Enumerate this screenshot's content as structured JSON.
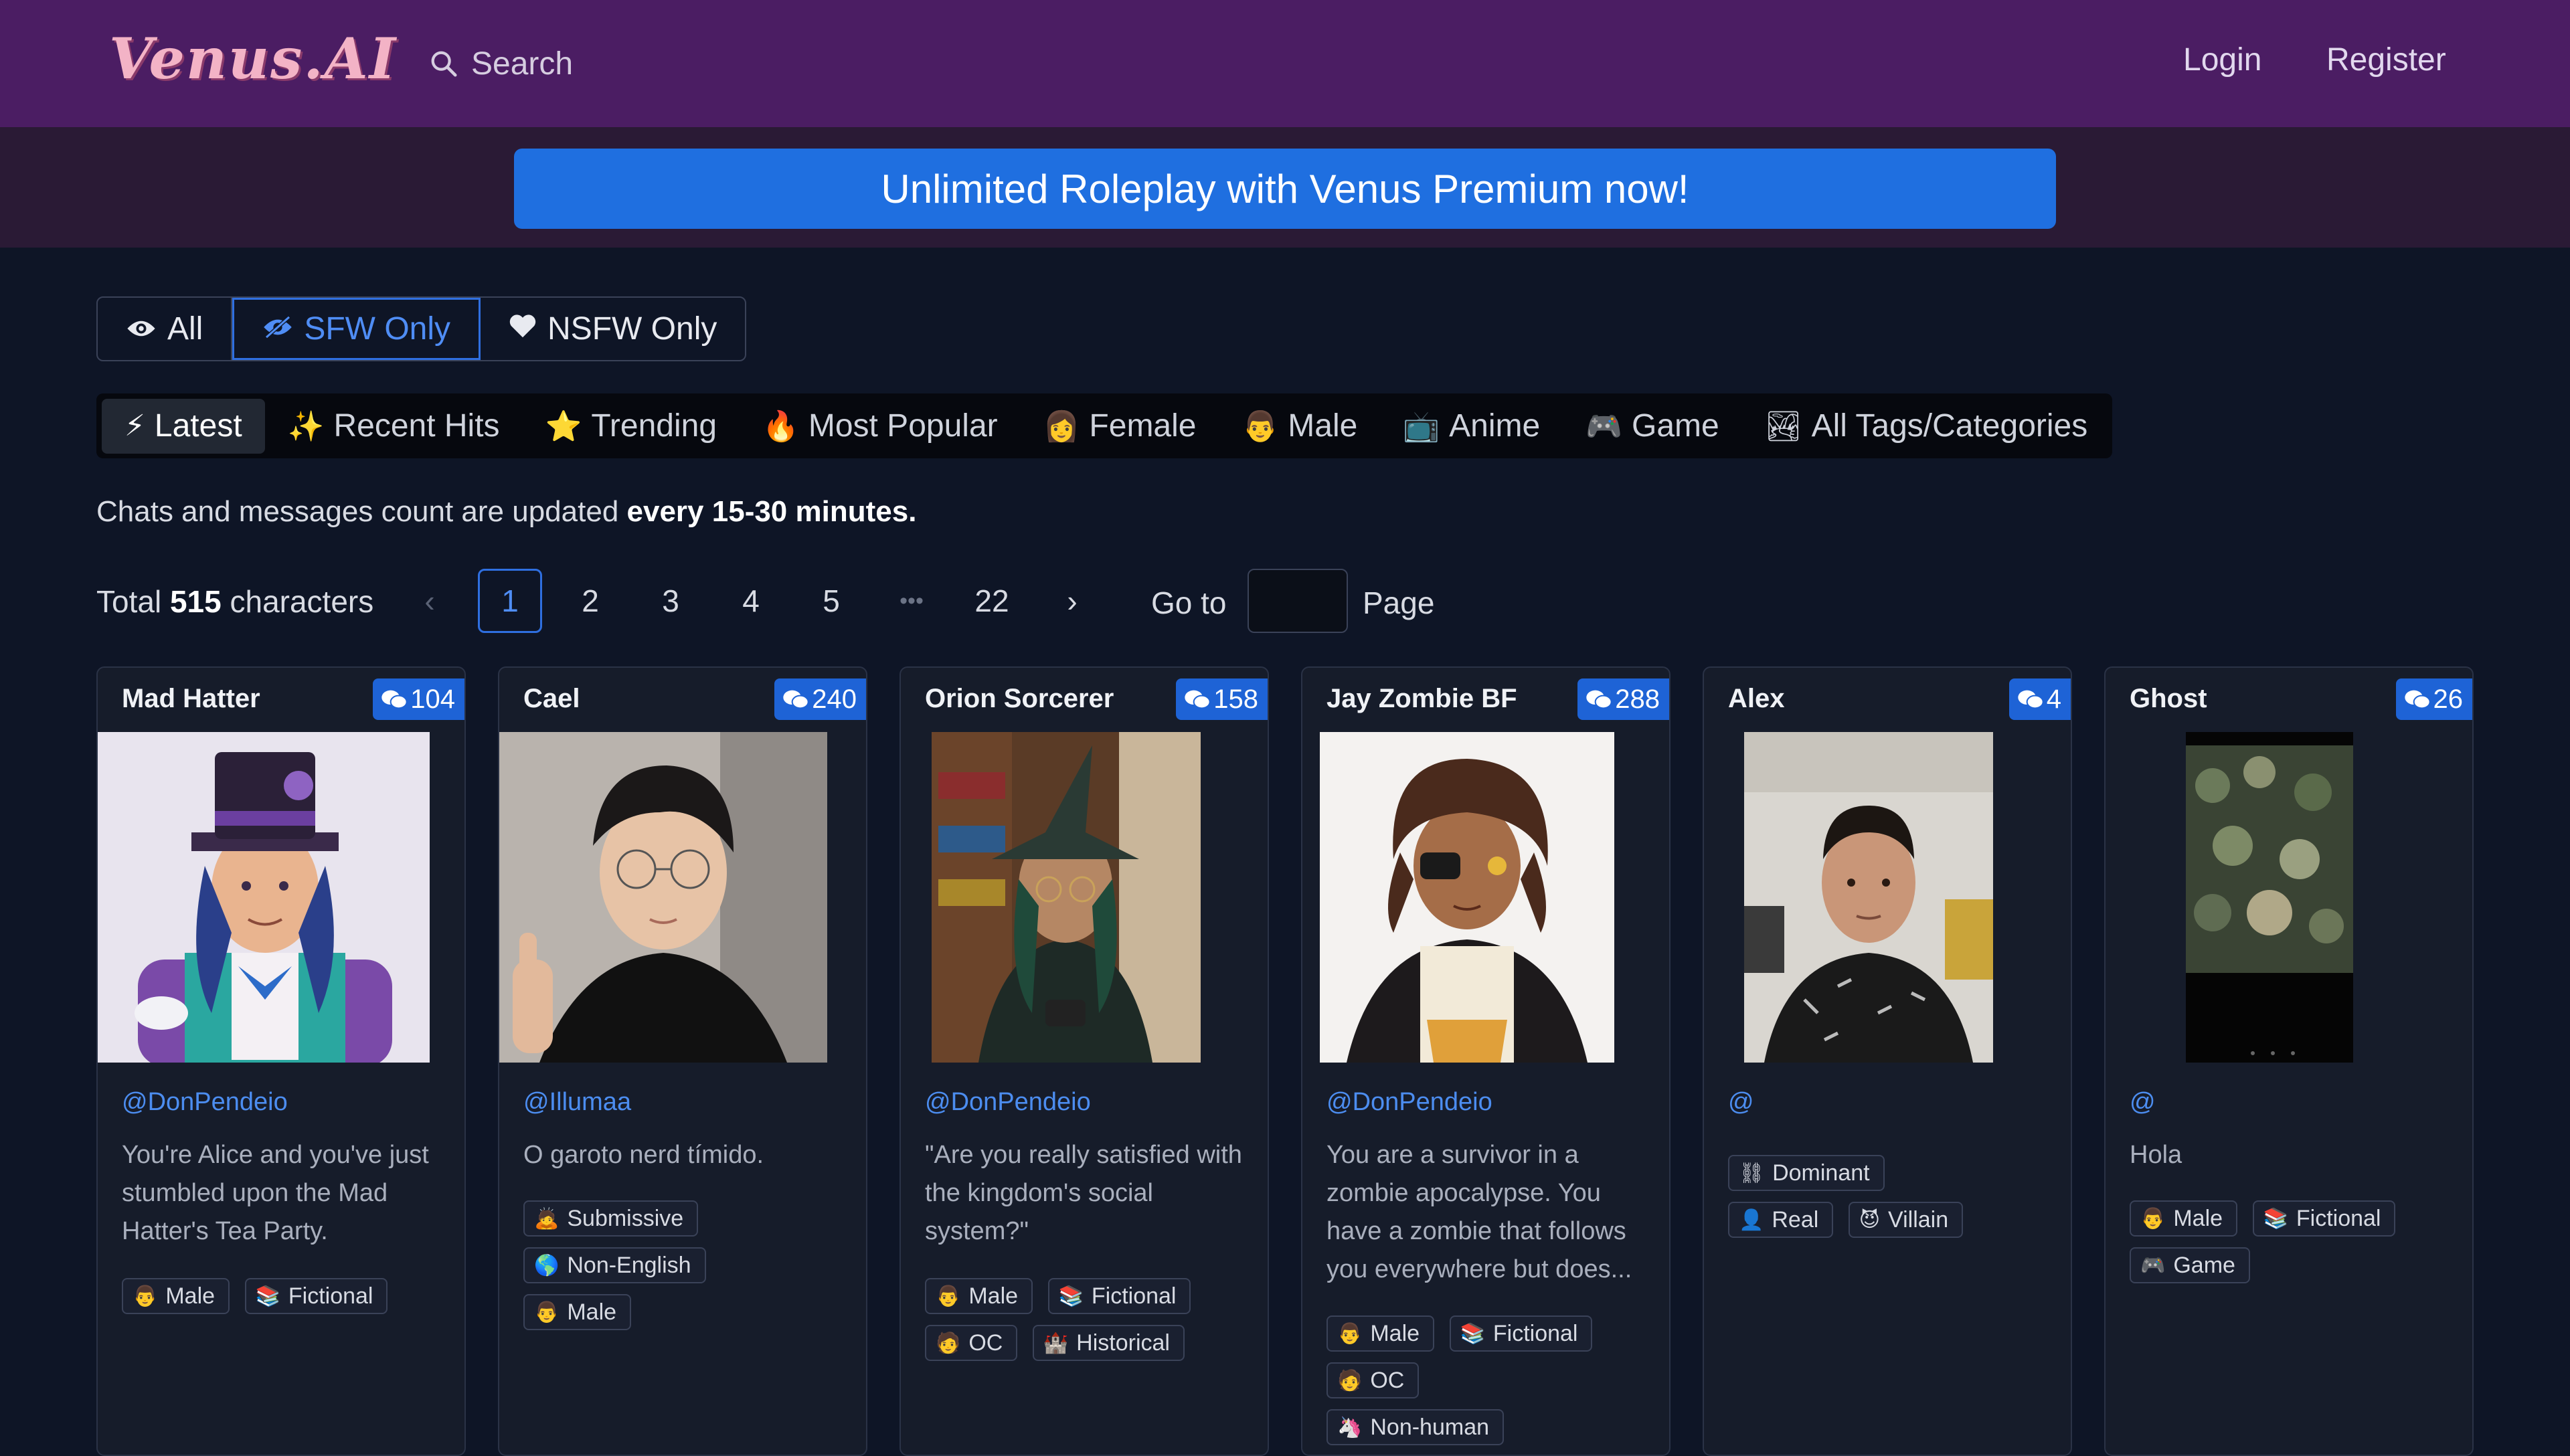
{
  "header": {
    "logo": "Venus.AI",
    "search_label": "Search",
    "login": "Login",
    "register": "Register"
  },
  "banner": {
    "text": "Unlimited Roleplay with Venus Premium now!"
  },
  "content_filter": {
    "options": [
      {
        "label": "All",
        "icon": "eye-icon"
      },
      {
        "label": "SFW Only",
        "icon": "eye-slash-icon",
        "active": true
      },
      {
        "label": "NSFW Only",
        "icon": "heart-icon"
      }
    ]
  },
  "tabs": [
    {
      "label": "Latest",
      "icon": "⚡",
      "active": true
    },
    {
      "label": "Recent Hits",
      "icon": "✨"
    },
    {
      "label": "Trending",
      "icon": "⭐"
    },
    {
      "label": "Most Popular",
      "icon": "🔥"
    },
    {
      "label": "Female",
      "icon": "👩"
    },
    {
      "label": "Male",
      "icon": "👨"
    },
    {
      "label": "Anime",
      "icon": "📺"
    },
    {
      "label": "Game",
      "icon": "🎮"
    },
    {
      "label": "All Tags/Categories",
      "icon": "🏞"
    }
  ],
  "notice": {
    "prefix": "Chats and messages count are updated ",
    "bold": "every 15-30 minutes."
  },
  "pagination": {
    "total_prefix": "Total ",
    "total_count": "515",
    "total_suffix": " characters",
    "prev": "‹",
    "pages": [
      "1",
      "2",
      "3",
      "4",
      "5"
    ],
    "ellipsis": "•••",
    "last_page": "22",
    "next": "›",
    "current": "1",
    "goto_label": "Go to",
    "page_label": "Page",
    "goto_value": ""
  },
  "characters": [
    {
      "name": "Mad Hatter",
      "count": "104",
      "handle": "@DonPendeio",
      "description": "You're Alice and you've just stumbled upon the Mad Hatter's Tea Party.",
      "tags": [
        {
          "label": "Male",
          "icon": "👨"
        },
        {
          "label": "Fictional",
          "icon": "📚"
        }
      ]
    },
    {
      "name": "Cael",
      "count": "240",
      "handle": "@Illumaa",
      "description": "O garoto nerd tímido.",
      "tags": [
        {
          "label": "Submissive",
          "icon": "🙇"
        },
        {
          "label": "Non-English",
          "icon": "🌎"
        },
        {
          "label": "Male",
          "icon": "👨"
        }
      ]
    },
    {
      "name": "Orion Sorcerer",
      "count": "158",
      "handle": "@DonPendeio",
      "description": "\"Are you really satisfied with the kingdom's social system?\"",
      "tags": [
        {
          "label": "Male",
          "icon": "👨"
        },
        {
          "label": "Fictional",
          "icon": "📚"
        },
        {
          "label": "OC",
          "icon": "🧑"
        },
        {
          "label": "Historical",
          "icon": "🏰"
        }
      ]
    },
    {
      "name": "Jay Zombie BF",
      "count": "288",
      "handle": "@DonPendeio",
      "description": "You are a survivor in a zombie apocalypse. You have a zombie that follows you everywhere but does...",
      "tags": [
        {
          "label": "Male",
          "icon": "👨"
        },
        {
          "label": "Fictional",
          "icon": "📚"
        },
        {
          "label": "OC",
          "icon": "🧑"
        },
        {
          "label": "Non-human",
          "icon": "🦄"
        }
      ]
    },
    {
      "name": "Alex",
      "count": "4",
      "handle": "@",
      "description": "",
      "tags": [
        {
          "label": "Dominant",
          "icon": "⛓"
        },
        {
          "label": "Real",
          "icon": "👤"
        },
        {
          "label": "Villain",
          "icon": "😈"
        }
      ]
    },
    {
      "name": "Ghost",
      "count": "26",
      "handle": "@",
      "description": "Hola",
      "tags": [
        {
          "label": "Male",
          "icon": "👨"
        },
        {
          "label": "Fictional",
          "icon": "📚"
        },
        {
          "label": "Game",
          "icon": "🎮"
        }
      ]
    }
  ],
  "colors": {
    "header_bg": "#4b1d63",
    "banner_strip_bg": "#2a1a35",
    "accent_blue": "#1f6fe0",
    "page_bg": "#0e1526",
    "card_bg": "#161c2a",
    "handle_blue": "#4c8df0"
  }
}
